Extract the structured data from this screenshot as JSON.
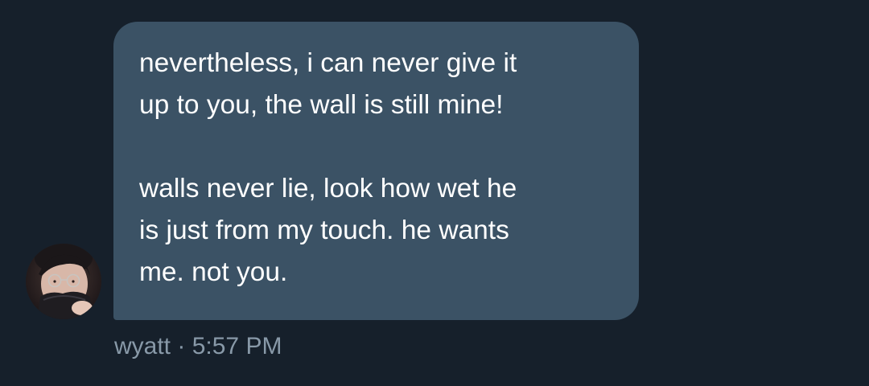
{
  "message": {
    "lines": [
      "nevertheless, i can never give it",
      "up to you, the wall is still mine!",
      "walls never lie, look how wet he",
      "is just from my touch. he wants",
      "me. not you."
    ],
    "sender": "wyatt",
    "separator": "·",
    "time": "5:57 PM"
  },
  "colors": {
    "background": "#16202b",
    "bubble": "#3b5265",
    "message_text": "#ffffff",
    "meta_text": "#8899a8"
  }
}
